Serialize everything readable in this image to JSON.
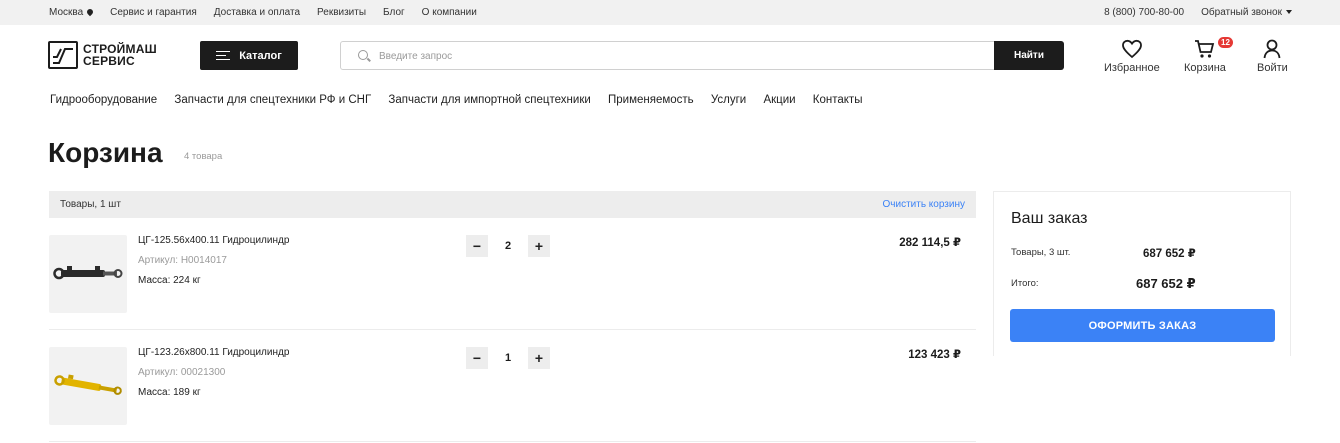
{
  "topbar": {
    "city": "Москва",
    "links": [
      "Сервис и гарантия",
      "Доставка и оплата",
      "Реквизиты",
      "Блог",
      "О компании"
    ],
    "phone": "8 (800) 700-80-00",
    "callback": "Обратный звонок"
  },
  "header": {
    "logo_line1": "СТРОЙМАШ",
    "logo_line2": "СЕРВИС",
    "catalog_label": "Каталог",
    "search_placeholder": "Введите запрос",
    "search_button": "Найти",
    "favorites_label": "Избранное",
    "cart_label": "Корзина",
    "cart_badge": "12",
    "login_label": "Войти"
  },
  "nav": [
    "Гидрооборудование",
    "Запчасти для спецтехники РФ и СНГ",
    "Запчасти для импортной спецтехники",
    "Применяемость",
    "Услуги",
    "Акции",
    "Контакты"
  ],
  "page": {
    "title": "Корзина",
    "count": "4 товара"
  },
  "cart": {
    "header_left": "Товары, 1 шт",
    "clear_label": "Очистить корзину",
    "items": [
      {
        "name": "ЦГ-125.56х400.11 Гидроцилиндр",
        "sku": "Артикул: Н0014017",
        "mass": "Масса: 224 кг",
        "qty": "2",
        "price": "282 114,5 ₽",
        "color": "#2b2b2b"
      },
      {
        "name": "ЦГ-123.26х800.11 Гидроцилиндр",
        "sku": "Артикул: 00021300",
        "mass": "Масса: 189 кг",
        "qty": "1",
        "price": "123 423 ₽",
        "color": "#e2b400"
      }
    ]
  },
  "summary": {
    "title": "Ваш заказ",
    "goods_label": "Товары, 3 шт.",
    "goods_value": "687 652 ₽",
    "total_label": "Итого:",
    "total_value": "687 652 ₽",
    "checkout_label": "ОФОРМИТЬ ЗАКАЗ"
  },
  "colors": {
    "accent": "#3b82f6",
    "dark": "#1c1c1c",
    "badge": "#e53935"
  }
}
